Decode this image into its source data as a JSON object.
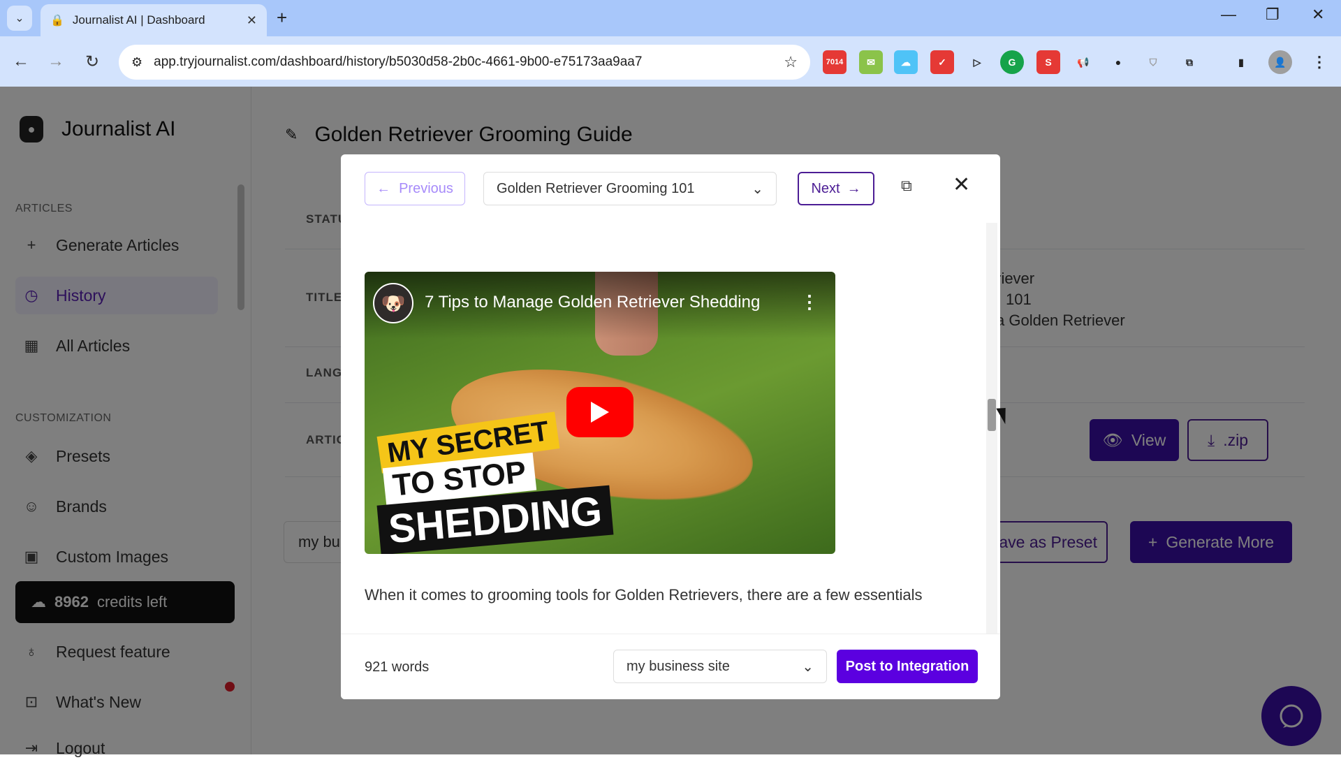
{
  "browser": {
    "tab_title": "Journalist AI | Dashboard",
    "url": "app.tryjournalist.com/dashboard/history/b5030d58-2b0c-4661-9b00-e75173aa9aa7",
    "extension_badge": "7014"
  },
  "sidebar": {
    "brand": "Journalist AI",
    "section_articles": "ARTICLES",
    "section_customization": "CUSTOMIZATION",
    "items": [
      {
        "label": "Generate Articles",
        "icon": "plus-icon"
      },
      {
        "label": "History",
        "icon": "clock-icon",
        "active": true
      },
      {
        "label": "All Articles",
        "icon": "grid-icon"
      },
      {
        "label": "Presets",
        "icon": "layers-icon"
      },
      {
        "label": "Brands",
        "icon": "smile-icon"
      },
      {
        "label": "Custom Images",
        "icon": "image-icon"
      },
      {
        "label": "Request feature",
        "icon": "bulb-icon"
      },
      {
        "label": "What's New",
        "icon": "inbox-icon"
      },
      {
        "label": "Logout",
        "icon": "logout-icon"
      }
    ],
    "credits_count": "8962",
    "credits_suffix": "credits left"
  },
  "main": {
    "page_title": "Golden Retriever Grooming Guide",
    "labels": [
      "STATU",
      "TITLE",
      "LANG",
      "ARTIC"
    ],
    "title_lines": [
      "triever",
      "101",
      "a Golden Retriever"
    ],
    "view_label": "View",
    "zip_label": ".zip",
    "input_value": "my bu",
    "save_preset_label": "Save as Preset",
    "generate_more_label": "Generate More"
  },
  "modal": {
    "prev_label": "Previous",
    "selected_article": "Golden Retriever Grooming 101",
    "next_label": "Next",
    "video": {
      "title": "7 Tips to Manage Golden Retriever Shedding",
      "thumb_line1": "MY SECRET",
      "thumb_line2": "TO STOP",
      "thumb_line3": "SHEDDING"
    },
    "paragraph": "When it comes to grooming tools for Golden Retrievers, there are a few essentials",
    "word_count": "921 words",
    "site_select": "my business site",
    "post_label": "Post to Integration"
  },
  "colors": {
    "accent": "#3b0fa8",
    "post_button": "#5b00e0",
    "browser_bar": "#d3e3fd"
  }
}
